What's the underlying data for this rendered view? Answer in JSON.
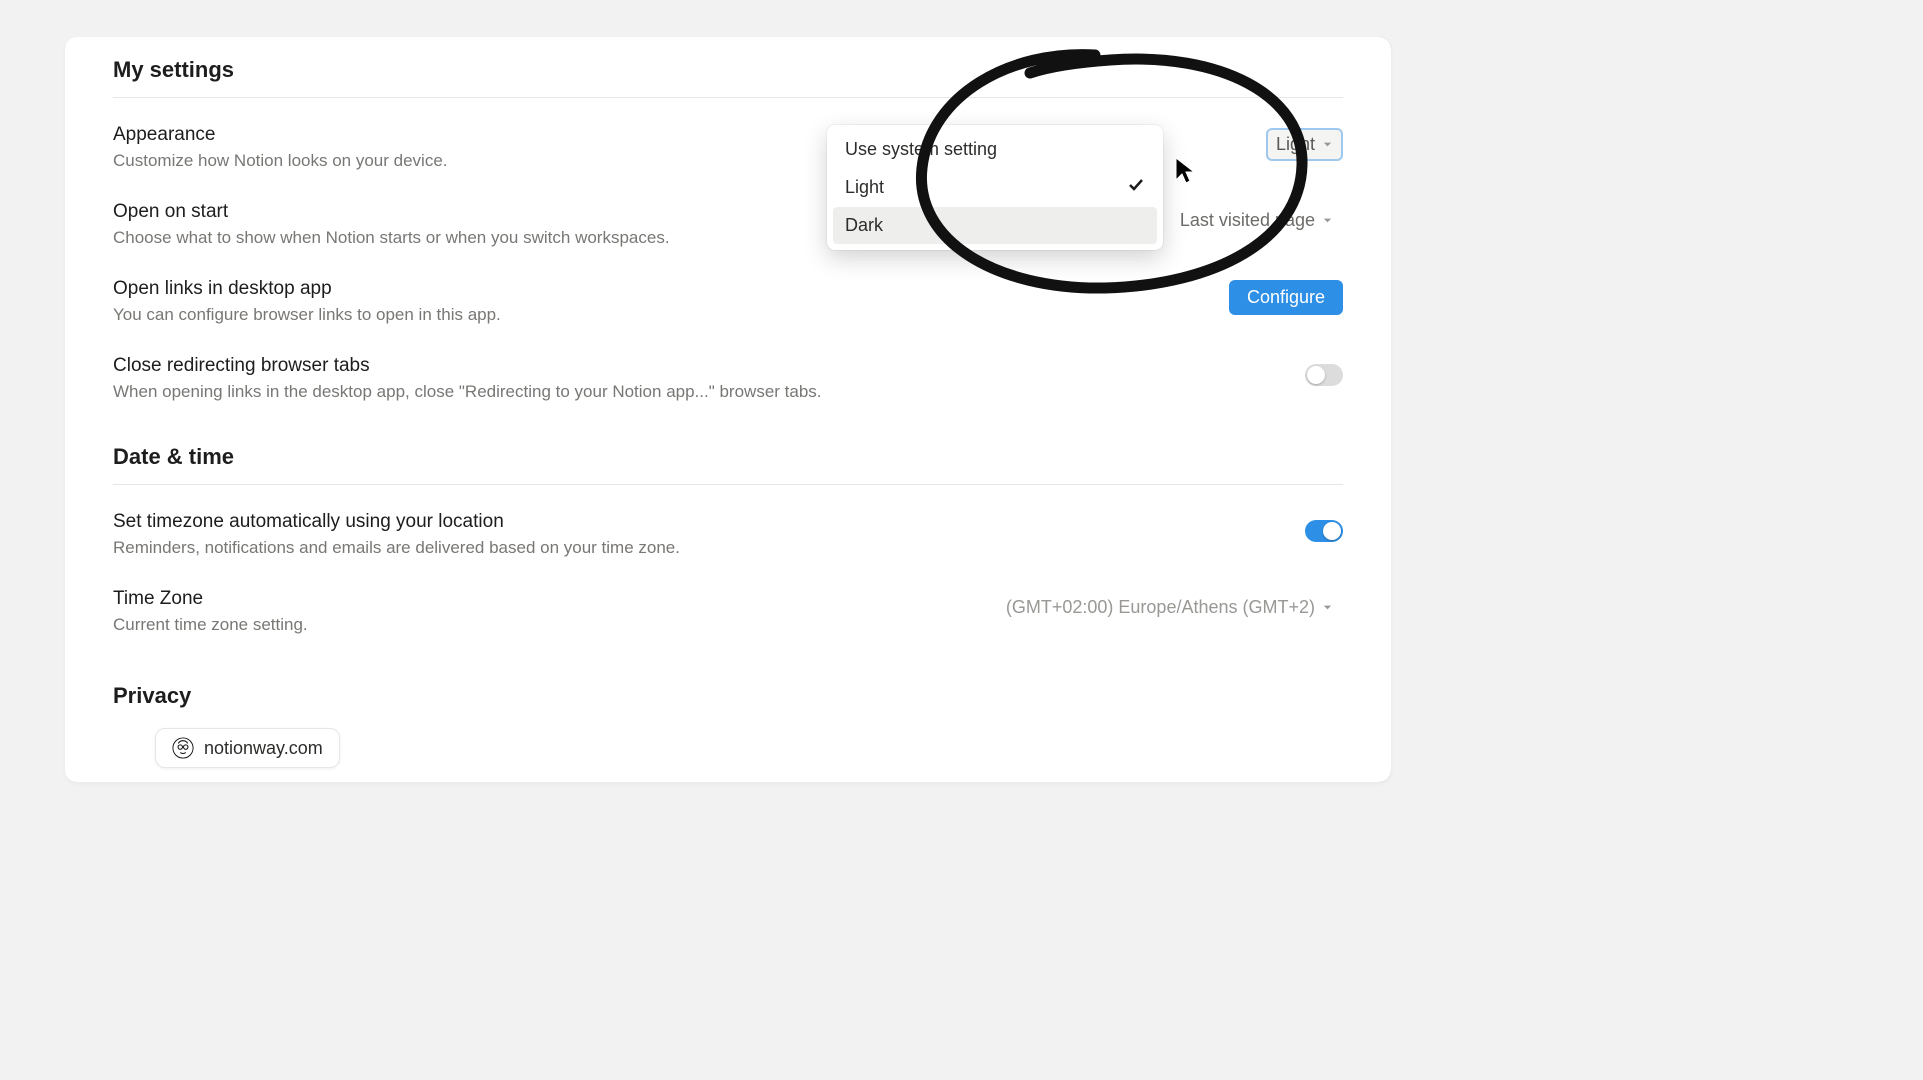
{
  "page": {
    "title": "My settings"
  },
  "sections": {
    "appearance": {
      "label": "Appearance",
      "desc": "Customize how Notion looks on your device.",
      "selected": "Light",
      "options": [
        "Use system setting",
        "Light",
        "Dark"
      ]
    },
    "open_on_start": {
      "label": "Open on start",
      "desc": "Choose what to show when Notion starts or when you switch workspaces.",
      "selected": "Last visited page"
    },
    "open_links_desktop": {
      "label": "Open links in desktop app",
      "desc": "You can configure browser links to open in this app.",
      "button": "Configure"
    },
    "close_redirecting": {
      "label": "Close redirecting browser tabs",
      "desc": "When opening links in the desktop app, close \"Redirecting to your Notion app...\" browser tabs.",
      "toggle": false
    },
    "date_time_title": "Date & time",
    "auto_timezone": {
      "label": "Set timezone automatically using your location",
      "desc": "Reminders, notifications and emails are delivered based on your time zone.",
      "toggle": true
    },
    "timezone": {
      "label": "Time Zone",
      "desc": "Current time zone setting.",
      "selected": "(GMT+02:00) Europe/Athens (GMT+2)"
    },
    "privacy_title": "Privacy"
  },
  "watermark": {
    "text": "notionway.com"
  }
}
